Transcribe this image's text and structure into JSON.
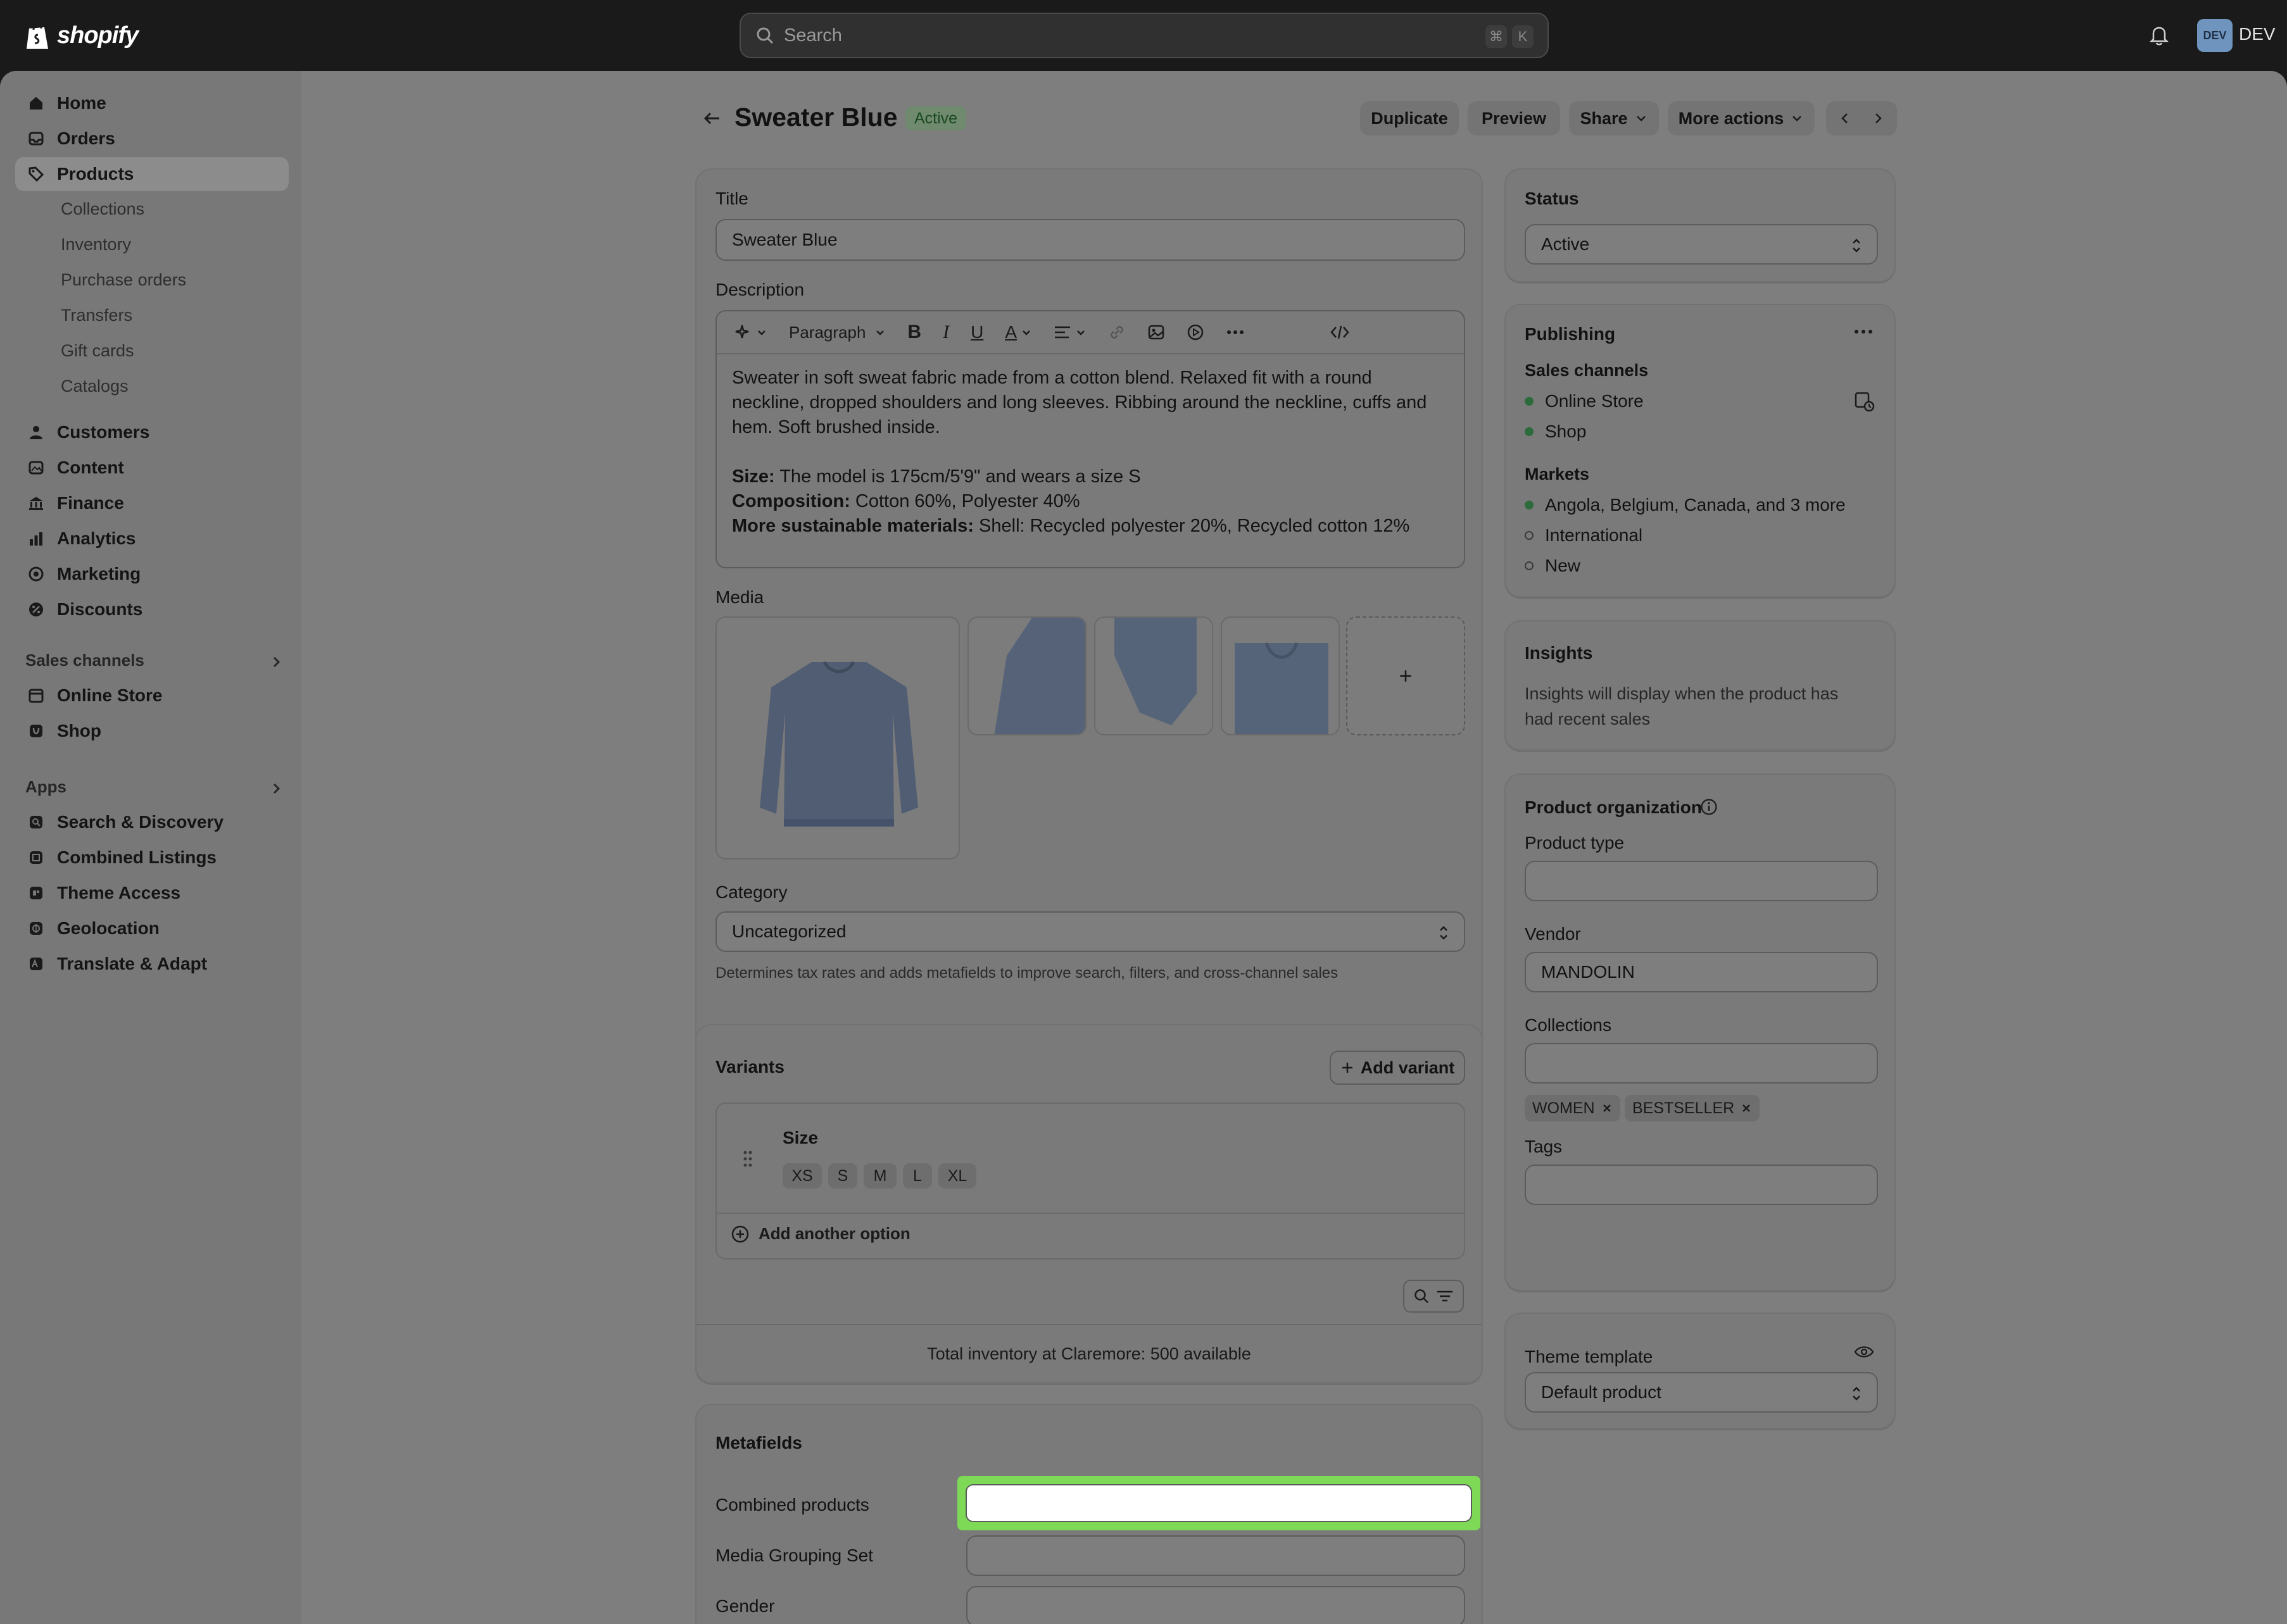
{
  "topbar": {
    "brand": "shopify",
    "search_placeholder": "Search",
    "shortcut_cmd": "⌘",
    "shortcut_key": "K",
    "avatar_initials": "DEV",
    "user": "DEV"
  },
  "sidebar": {
    "main": [
      {
        "label": "Home",
        "icon": "home-icon"
      },
      {
        "label": "Orders",
        "icon": "inbox-icon"
      },
      {
        "label": "Products",
        "icon": "tag-icon"
      }
    ],
    "product_sub": [
      "Collections",
      "Inventory",
      "Purchase orders",
      "Transfers",
      "Gift cards",
      "Catalogs"
    ],
    "more": [
      {
        "label": "Customers",
        "icon": "person-icon"
      },
      {
        "label": "Content",
        "icon": "content-icon"
      },
      {
        "label": "Finance",
        "icon": "bank-icon"
      },
      {
        "label": "Analytics",
        "icon": "bar-chart-icon"
      },
      {
        "label": "Marketing",
        "icon": "target-icon"
      },
      {
        "label": "Discounts",
        "icon": "discount-icon"
      }
    ],
    "sales_channels_title": "Sales channels",
    "sales_channels": [
      "Online Store",
      "Shop"
    ],
    "apps_title": "Apps",
    "apps": [
      "Search & Discovery",
      "Combined Listings",
      "Theme Access",
      "Geolocation",
      "Translate & Adapt"
    ]
  },
  "header": {
    "title": "Sweater Blue",
    "status_badge": "Active",
    "duplicate": "Duplicate",
    "preview": "Preview",
    "share": "Share",
    "more_actions": "More actions"
  },
  "main": {
    "title_label": "Title",
    "title_value": "Sweater Blue",
    "description_label": "Description",
    "toolbar_paragraph": "Paragraph",
    "description_p1": "Sweater in soft sweat fabric made from a cotton blend. Relaxed fit with a round neckline, dropped shoulders and long sleeves. Ribbing around the neckline, cuffs and hem. Soft brushed inside.",
    "size_label": "Size:",
    "size_text": " The model is 175cm/5'9\" and wears a size S",
    "composition_label": "Composition:",
    "composition_text": " Cotton 60%, Polyester 40%",
    "sustainable_label": "More sustainable materials:",
    "sustainable_text": " Shell: Recycled polyester 20%, Recycled cotton 12%",
    "media_label": "Media",
    "media_add": "+",
    "category_label": "Category",
    "category_value": "Uncategorized",
    "category_help": "Determines tax rates and adds metafields to improve search, filters, and cross-channel sales"
  },
  "variants": {
    "title": "Variants",
    "add_variant": "Add variant",
    "option_name": "Size",
    "values": [
      "XS",
      "S",
      "M",
      "L",
      "XL"
    ],
    "add_option": "Add another option",
    "inventory_total": "Total inventory at Claremore: 500 available"
  },
  "metafields": {
    "title": "Metafields",
    "fields": [
      "Combined products",
      "Media Grouping Set",
      "Gender"
    ]
  },
  "status_card": {
    "title": "Status",
    "value": "Active"
  },
  "publishing": {
    "title": "Publishing",
    "sales_channels_label": "Sales channels",
    "channels": [
      "Online Store",
      "Shop"
    ],
    "markets_label": "Markets",
    "markets": [
      {
        "label": "Angola, Belgium, Canada, and 3 more",
        "active": true
      },
      {
        "label": "International",
        "active": false
      },
      {
        "label": "New",
        "active": false
      }
    ]
  },
  "insights": {
    "title": "Insights",
    "text": "Insights will display when the product has had recent sales"
  },
  "organization": {
    "title": "Product organization",
    "product_type_label": "Product type",
    "product_type_value": "",
    "vendor_label": "Vendor",
    "vendor_value": "MANDOLIN",
    "collections_label": "Collections",
    "collection_tags": [
      "WOMEN",
      "BESTSELLER"
    ],
    "tags_label": "Tags"
  },
  "theme": {
    "title": "Theme template",
    "value": "Default product"
  },
  "colors": {
    "active_badge_bg": "#6f8a6e",
    "active_badge_text": "#1b4a22",
    "highlight_border": "#7ed957",
    "market_dot": "#2d6b3c"
  }
}
